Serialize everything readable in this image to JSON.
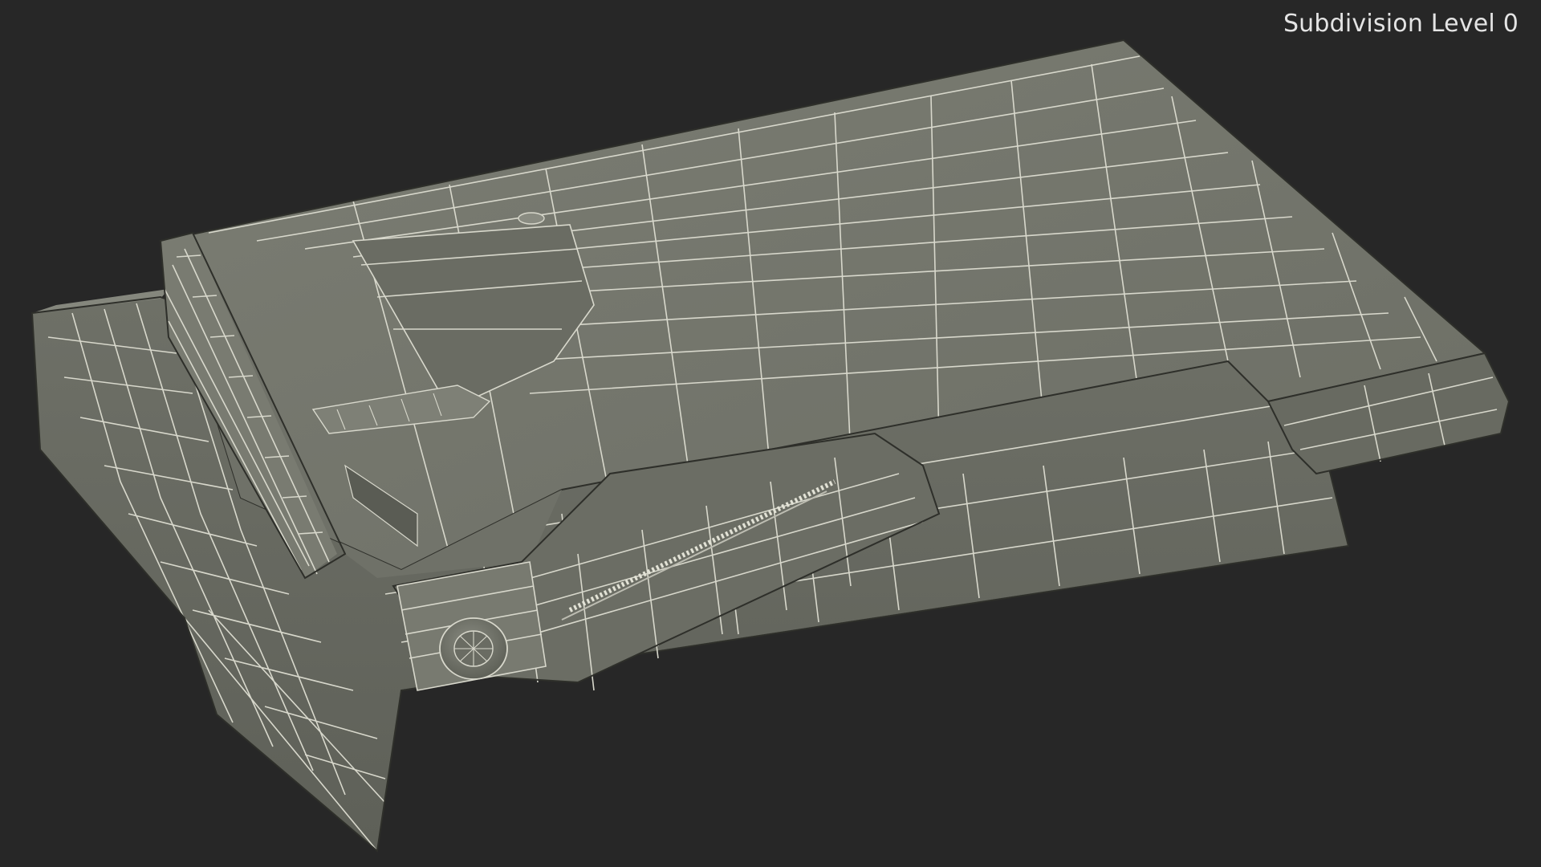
{
  "viewport": {
    "subdivision_label": "Subdivision Level 0",
    "background_color": "#272727",
    "mesh_color": "#74766c",
    "mesh_shadow_color": "#5c5e55",
    "wire_color": "#d8d8cc"
  },
  "icons": {
    "model": "folded-jeans-wireframe",
    "button": "jeans-button-icon",
    "zipper": "zipper-icon",
    "rivet": "rivet-icon"
  }
}
